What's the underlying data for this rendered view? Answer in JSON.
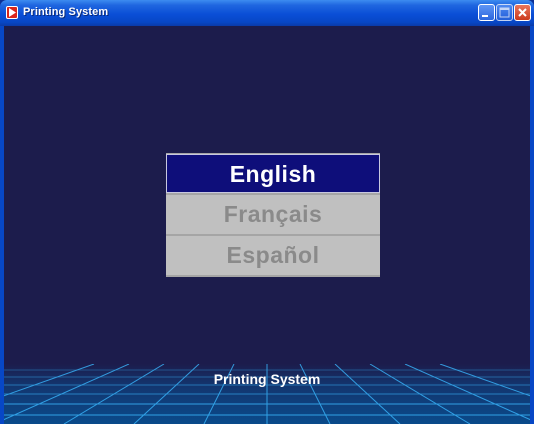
{
  "window": {
    "title": "Printing System",
    "icons": {
      "app": "app-icon",
      "minimize": "minimize-icon",
      "maximize": "maximize-icon",
      "close": "close-icon"
    }
  },
  "languages": [
    {
      "label": "English",
      "selected": true
    },
    {
      "label": "Français",
      "selected": false
    },
    {
      "label": "Español",
      "selected": false
    }
  ],
  "footer": {
    "label": "Printing System"
  },
  "colors": {
    "background": "#1c1c4c",
    "selected_item": "#0e0e7a",
    "unselected_item": "#c0c0c0",
    "grid": "#3ab8ff"
  }
}
